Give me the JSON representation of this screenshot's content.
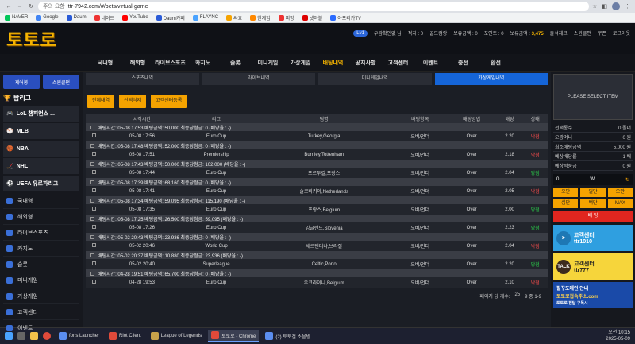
{
  "browser": {
    "security": "주의 요함",
    "url": "ttr-7942.com/#/bets/virtual-game",
    "bookmarks": [
      "NAVER",
      "Google",
      "Daum",
      "네이트",
      "YouTube",
      "Daum카페",
      "FLAYNC",
      "싸교",
      "한게임",
      "피망",
      "넷마블",
      "아프리카TV"
    ]
  },
  "header": {
    "logo": "토토로",
    "level": "Lv1",
    "username": "우람확인없 님",
    "points_label": "적치 : 0",
    "gold_label": "골드캠랑",
    "cash_label": "보유금액 : 0",
    "point_label": "포인트 : 0",
    "bonus_label": "보유금액 :",
    "bonus_value": "3,475",
    "attend": "출석체크",
    "service": "스윈쿨펀",
    "coupon": "쿠폰",
    "logout": "로그아웃"
  },
  "nav": [
    "국내형",
    "해외형",
    "라이브스포츠",
    "카지노",
    "슬롯",
    "미니게임",
    "가상게임",
    "배팅내역",
    "공지사항",
    "고객센터",
    "이벤트",
    "충전",
    "환전"
  ],
  "nav_active_index": 7,
  "sidebar": {
    "quick": [
      "제어봉",
      "스윈쿨펀"
    ],
    "title": "탑리그",
    "leagues": [
      "LoL 챔피언스 ...",
      "MLB",
      "NBA",
      "NHL",
      "UEFA 유로파리그"
    ],
    "menu": [
      "국내형",
      "해외형",
      "라이브스포츠",
      "카지노",
      "슬롯",
      "미니게임",
      "가상게임",
      "고객센터",
      "이벤트"
    ]
  },
  "subtabs": [
    "스포츠내역",
    "라이브내역",
    "미니게임내역",
    "가상게임내역"
  ],
  "subtab_active": 3,
  "filters": [
    "전체내역",
    "선택삭제",
    "고객센터등록"
  ],
  "table": {
    "headers": [
      "",
      "시작시간",
      "리그",
      "팀명",
      "배팅항목",
      "배팅방법",
      "배당",
      "상태"
    ],
    "groups": [
      {
        "info": "배팅시간: 05-08 17:53  배팅금액: 50,000  최종당첨금: 0 (배당율 : -)",
        "time": "05-08 17:56",
        "league": "Euro Cup",
        "team": "Turkey,Georgia",
        "pick": "오버/언더",
        "method": "Over",
        "odds": "2.20",
        "status": "낙첨",
        "win": false
      },
      {
        "info": "배팅시간: 05-08 17:48  배팅금액: 52,000  최종당첨금: 0 (배당율 : -)",
        "time": "05-08 17:51",
        "league": "Premiership",
        "team": "Burnley,Tottenham",
        "pick": "오버/언더",
        "method": "Over",
        "odds": "2.18",
        "status": "낙첨",
        "win": false
      },
      {
        "info": "배팅시간: 05-08 17:43  배팅금액: 50,000  최종당첨금: 102,000 (배당율 : -)",
        "time": "05-08 17:44",
        "league": "Euro Cup",
        "team": "포르투갈,포랑스",
        "pick": "오버/언더",
        "method": "Over",
        "odds": "2.04",
        "status": "당첨",
        "win": true
      },
      {
        "info": "배팅시간: 05-08 17:39  배팅금액: 68,160  최종당첨금: 0 (배당율 : -)",
        "time": "05-08 17:41",
        "league": "Euro Cup",
        "team": "슬로바키아,Netherlands",
        "pick": "오버/언더",
        "method": "Over",
        "odds": "2.05",
        "status": "낙첨",
        "win": false
      },
      {
        "info": "배팅시간: 05-08 17:34  배팅금액: 59,095  최종당첨금: 115,190 (배당율 : -)",
        "time": "05-08 17:35",
        "league": "Euro Cup",
        "team": "프랑스,Belgium",
        "pick": "오버/언더",
        "method": "Over",
        "odds": "2.00",
        "status": "당첨",
        "win": true
      },
      {
        "info": "배팅시간: 05-08 17:25  배팅금액: 26,500  최종당첨금: 59,095 (배당율 : -)",
        "time": "05-08 17:26",
        "league": "Euro Cup",
        "team": "잉글랜드,Slovenia",
        "pick": "오버/언더",
        "method": "Over",
        "odds": "2.23",
        "status": "당첨",
        "win": true
      },
      {
        "info": "배팅시간: 05-02 20:43  배팅금액: 23,936  최종당첨금: 0 (배당율 : -)",
        "time": "05-02 20:46",
        "league": "World Cup",
        "team": "세르텐티나,브라질",
        "pick": "오버/언더",
        "method": "Over",
        "odds": "2.04",
        "status": "낙첨",
        "win": false
      },
      {
        "info": "배팅시간: 05-02 20:37  배팅금액: 10,880  최종당첨금: 23,936 (배당율 : -)",
        "time": "05-02 20:40",
        "league": "Superleague",
        "team": "Celtic,Porto",
        "pick": "오버/언더",
        "method": "Over",
        "odds": "2.20",
        "status": "당첨",
        "win": true
      },
      {
        "info": "배팅시간: 04-28 19:51  배팅금액: 65,700  최종당첨금: 0 (배당율 : -)",
        "time": "04-28 19:53",
        "league": "Euro Cup",
        "team": "우크라이나,Belgium",
        "pick": "오버/언더",
        "method": "Over",
        "odds": "2.10",
        "status": "낙첨",
        "win": false
      }
    ]
  },
  "pager": {
    "label": "페이지 당 개수:",
    "size": "25",
    "range": "9 중 1-9"
  },
  "slip": {
    "title": "PLEASE SELECT ITEM",
    "rows": [
      {
        "k": "선택통수",
        "v": "0 폴더"
      },
      {
        "k": "오광머니",
        "v": "0 원"
      },
      {
        "k": "최소배팅금액",
        "v": "5,000 원"
      },
      {
        "k": "예상배당률",
        "v": "1 배"
      },
      {
        "k": "예상적중금",
        "v": "0 원"
      }
    ],
    "amount": "0",
    "w_label": "W",
    "pads": [
      "오만",
      "일만",
      "오만",
      "십만",
      "백만",
      "MAX"
    ],
    "bet": "배 팅"
  },
  "banners": {
    "telegram_title": "고객센터",
    "telegram_id": "ttr1010",
    "kakao_title": "고객센터",
    "kakao_id": "ttr777",
    "kakao_badge": "TALK",
    "domain_title": "필꾸도메인 안내",
    "domain_value": "토토로접속주소.com",
    "channel": "토토로 전달 구독시"
  },
  "taskbar": {
    "apps": [
      "fons Launcher",
      "Riot Client",
      "League of Legends",
      "토토로 - Chrome",
      "(2) 토토걸 소음방 ..."
    ],
    "active_index": 3,
    "time": "오전 10:15",
    "date": "2025-05-09"
  },
  "colors": {
    "accent": "#f5a300",
    "logo": "#f5b400",
    "blue": "#1565d8",
    "lose": "#ff4d4d",
    "win": "#2bd14b"
  }
}
